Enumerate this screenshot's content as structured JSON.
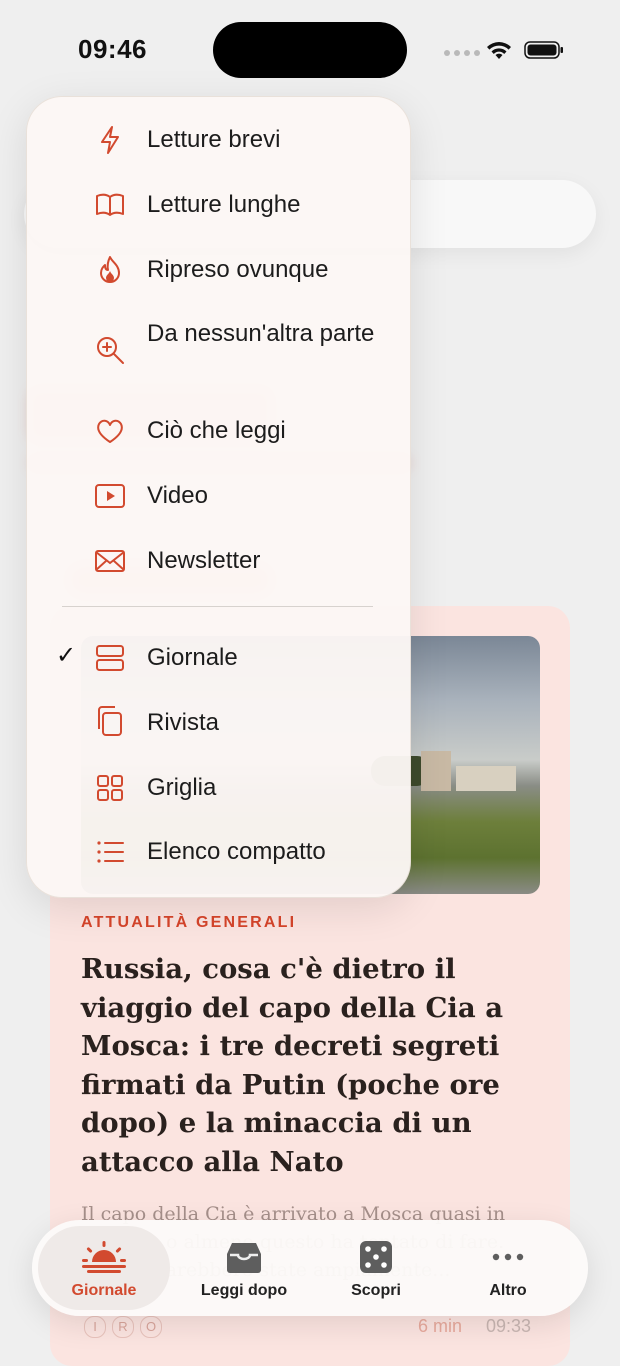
{
  "status_bar": {
    "time": "09:46"
  },
  "menu": {
    "filters": [
      {
        "label": "Letture brevi",
        "icon": "bolt-icon"
      },
      {
        "label": "Letture lunghe",
        "icon": "book-icon"
      },
      {
        "label": "Ripreso ovunque",
        "icon": "flame-icon"
      },
      {
        "label": "Da nessun'altra parte",
        "icon": "zoom-plus-icon"
      },
      {
        "label": "Ciò che leggi",
        "icon": "heart-icon"
      },
      {
        "label": "Video",
        "icon": "play-icon"
      },
      {
        "label": "Newsletter",
        "icon": "envelope-icon"
      }
    ],
    "layouts": [
      {
        "label": "Giornale",
        "icon": "rows-icon",
        "selected": true
      },
      {
        "label": "Rivista",
        "icon": "copy-icon",
        "selected": false
      },
      {
        "label": "Griglia",
        "icon": "grid-icon",
        "selected": false
      },
      {
        "label": "Elenco compatto",
        "icon": "list-icon",
        "selected": false
      }
    ]
  },
  "article": {
    "category": "ATTUALITÀ GENERALI",
    "headline": "Russia, cosa c'è dietro il viaggio del capo della Cia a Mosca: i tre decreti segreti firmati da Putin (poche ore dopo) e la minaccia di un attacco alla Nato",
    "excerpt": "Il capo della Cia è arrivato a Mosca quasi in silenzio, o almeno questo ha tentato di fare. Le voci sarebbero state ampiamente...",
    "tags": [
      "I",
      "R",
      "O"
    ],
    "read_time": "6 min",
    "time": "09:33"
  },
  "tabbar": {
    "tabs": [
      {
        "label": "Giornale",
        "icon": "sunrise-icon",
        "active": true
      },
      {
        "label": "Leggi dopo",
        "icon": "inbox-icon",
        "active": false
      },
      {
        "label": "Scopri",
        "icon": "dice-icon",
        "active": false
      },
      {
        "label": "Altro",
        "icon": "more-icon",
        "active": false
      }
    ]
  },
  "colors": {
    "accent": "#d24a2f",
    "card": "#fbe4e0"
  }
}
